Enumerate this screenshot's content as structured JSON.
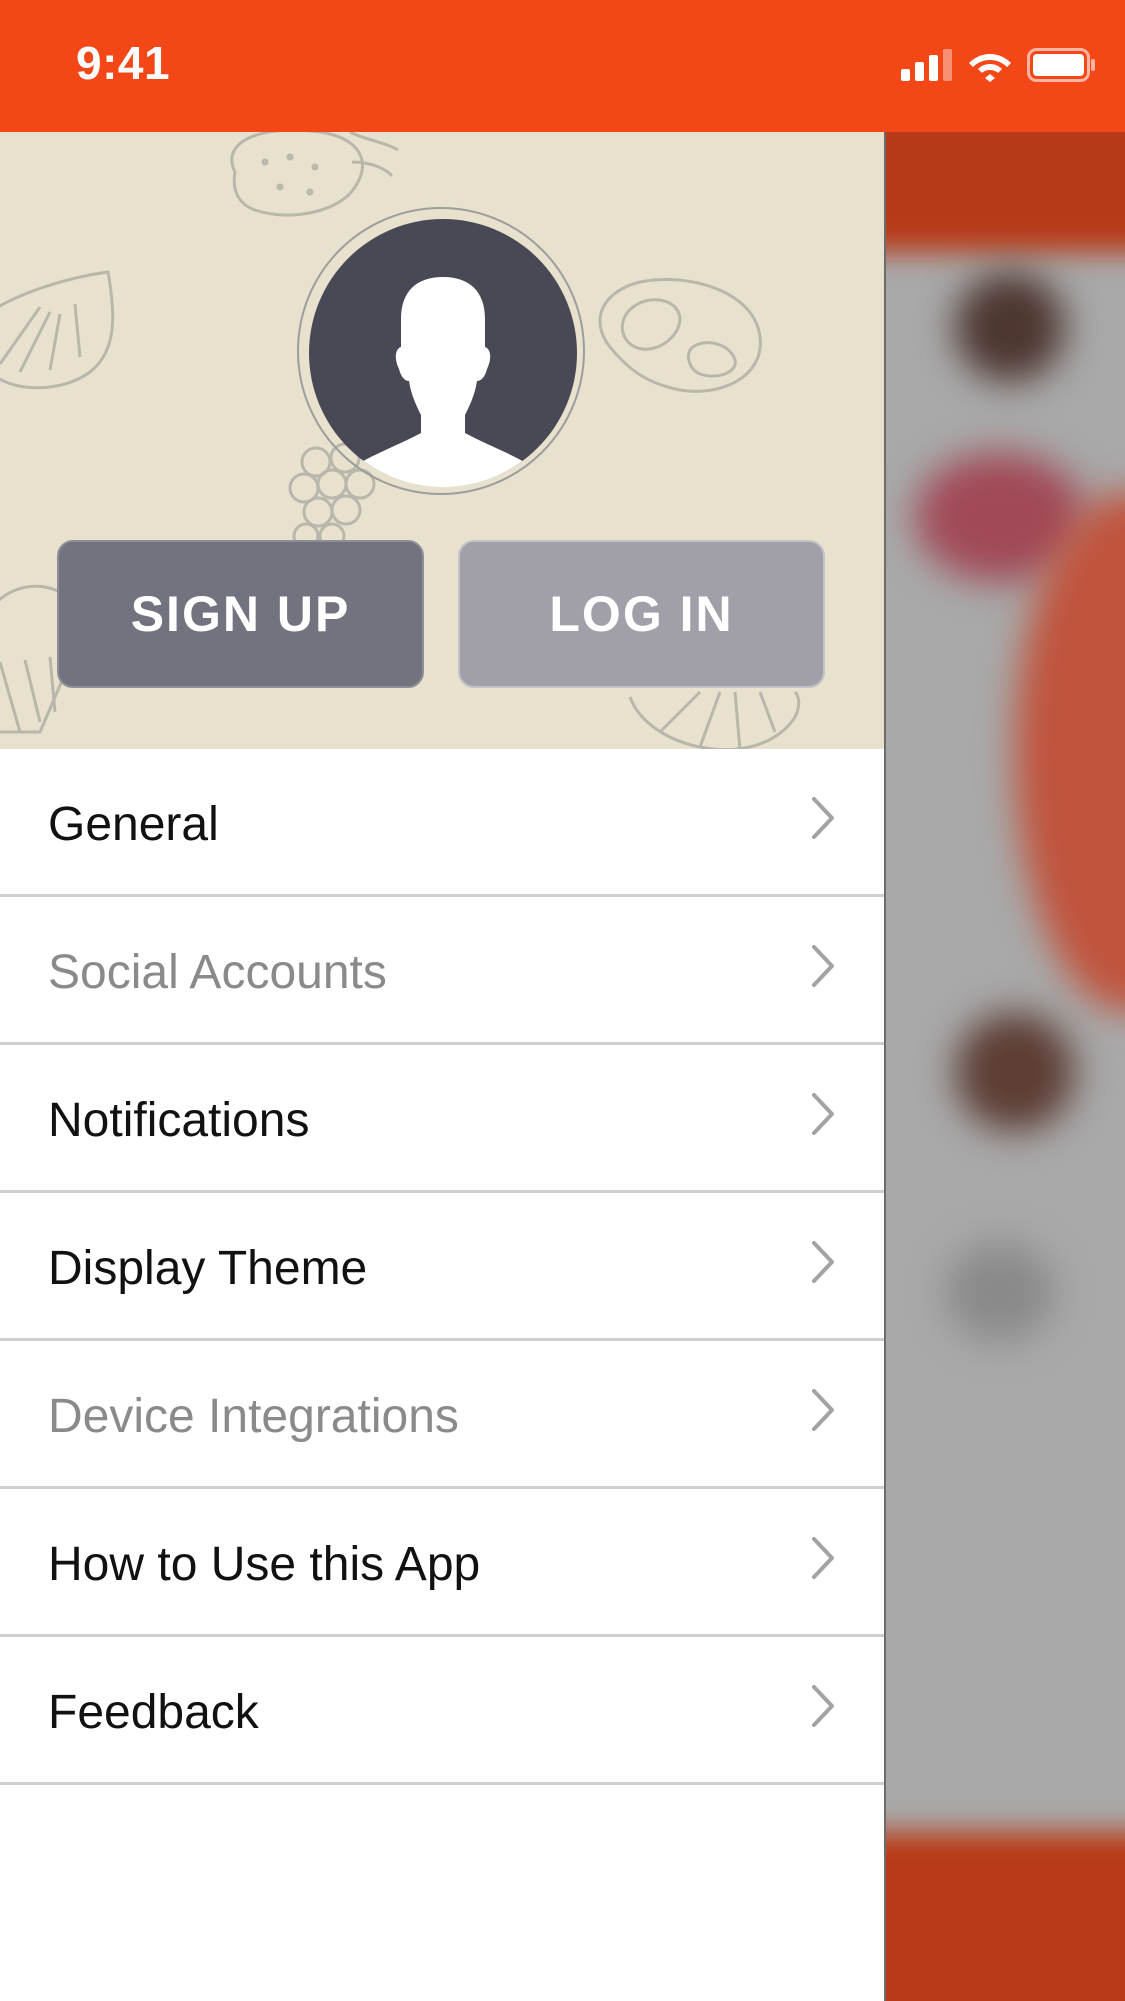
{
  "status_bar": {
    "time": "9:41",
    "color": "#f44718"
  },
  "drawer": {
    "header": {
      "background": "#e7e1ce",
      "avatar_icon": "user-silhouette-icon",
      "signup_label": "SIGN UP",
      "login_label": "LOG IN"
    },
    "menu": [
      {
        "label": "General",
        "enabled": true
      },
      {
        "label": "Social Accounts",
        "enabled": false
      },
      {
        "label": "Notifications",
        "enabled": true
      },
      {
        "label": "Display Theme",
        "enabled": true
      },
      {
        "label": "Device Integrations",
        "enabled": false
      },
      {
        "label": "How to Use this App",
        "enabled": true
      },
      {
        "label": "Feedback",
        "enabled": true
      }
    ]
  },
  "colors": {
    "accent": "#f44718",
    "avatar": "#494955",
    "signup_button": "#737380",
    "login_button": "#a1a0a8",
    "disabled_text": "#8a8a8a"
  }
}
